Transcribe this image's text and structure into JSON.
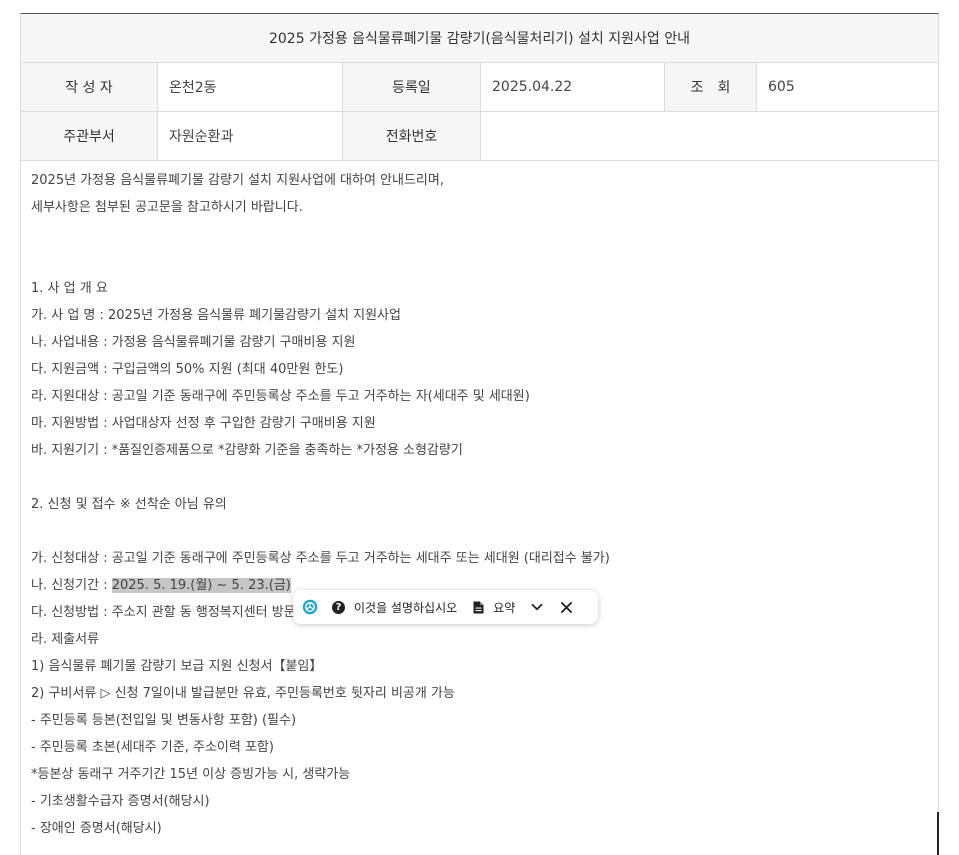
{
  "post": {
    "title": "2025 가정용 음식물류폐기물 감량기(음식물처리기) 설치 지원사업 안내",
    "author_label": "작 성 자",
    "author": "온천2동",
    "date_label": "등록일",
    "date": "2025.04.22",
    "views_label": "조　회",
    "views": "605",
    "dept_label": "주관부서",
    "dept": "자원순환과",
    "phone_label": "전화번호",
    "phone": ""
  },
  "body": {
    "lines": [
      "2025년 가정용 음식물류폐기물 감량기 설치 지원사업에 대하여 안내드리며,",
      "세부사항은 첨부된 공고문을 참고하시기 바랍니다.",
      "",
      "",
      "1. 사 업 개 요",
      "가. 사 업 명 : 2025년 가정용 음식물류 폐기물감량기 설치 지원사업",
      "나. 사업내용 : 가정용 음식물류폐기물 감량기 구매비용 지원",
      "다. 지원금액 : 구입금액의 50% 지원 (최대 40만원 한도)",
      "라. 지원대상 : 공고일 기준 동래구에 주민등록상 주소를 두고 거주하는 자(세대주 및 세대원)",
      "마. 지원방법 : 사업대상자 선정 후 구입한 감량기 구매비용 지원",
      "바. 지원기기 : *품질인증제품으로 *감량화 기준을 충족하는 *가정용 소형감량기",
      "",
      "2. 신청 및 접수 ※ 선착순 아님 유의",
      "",
      "가. 신청대상 : 공고일 기준 동래구에 주민등록상 주소를 두고 거주하는 세대주 또는 세대원 (대리접수 불가)"
    ],
    "period_prefix": "나. 신청기간 : ",
    "period_value": "2025. 5. 19.(월) ~ 5. 23.(금)",
    "method_line": "다. 신청방법 : 주소지 관할 동 행정복지센터 방문",
    "lines2": [
      "라. 제출서류",
      "1) 음식물류 폐기물 감량기 보급 지원 신청서【붙임】",
      "2) 구비서류 ▷ 신청 7일이내 발급분만 유효, 주민등록번호 뒷자리 비공개 가능",
      "- 주민등록 등본(전입일 및 변동사항 포함) (필수)",
      "- 주민등록 초본(세대주 기준, 주소이력 포함)",
      "*등본상 동래구 거주기간 15년 이상 증빙가능 시, 생략가능",
      "- 기초생활수급자 증명서(해당시)",
      "- 장애인 증명서(해당시)"
    ]
  },
  "popup": {
    "explain_label": "이것을 설명하십시오",
    "summary_label": "요약",
    "icons": [
      "chatgpt-icon",
      "question-icon",
      "document-icon",
      "chevron-down-icon",
      "close-icon"
    ]
  }
}
